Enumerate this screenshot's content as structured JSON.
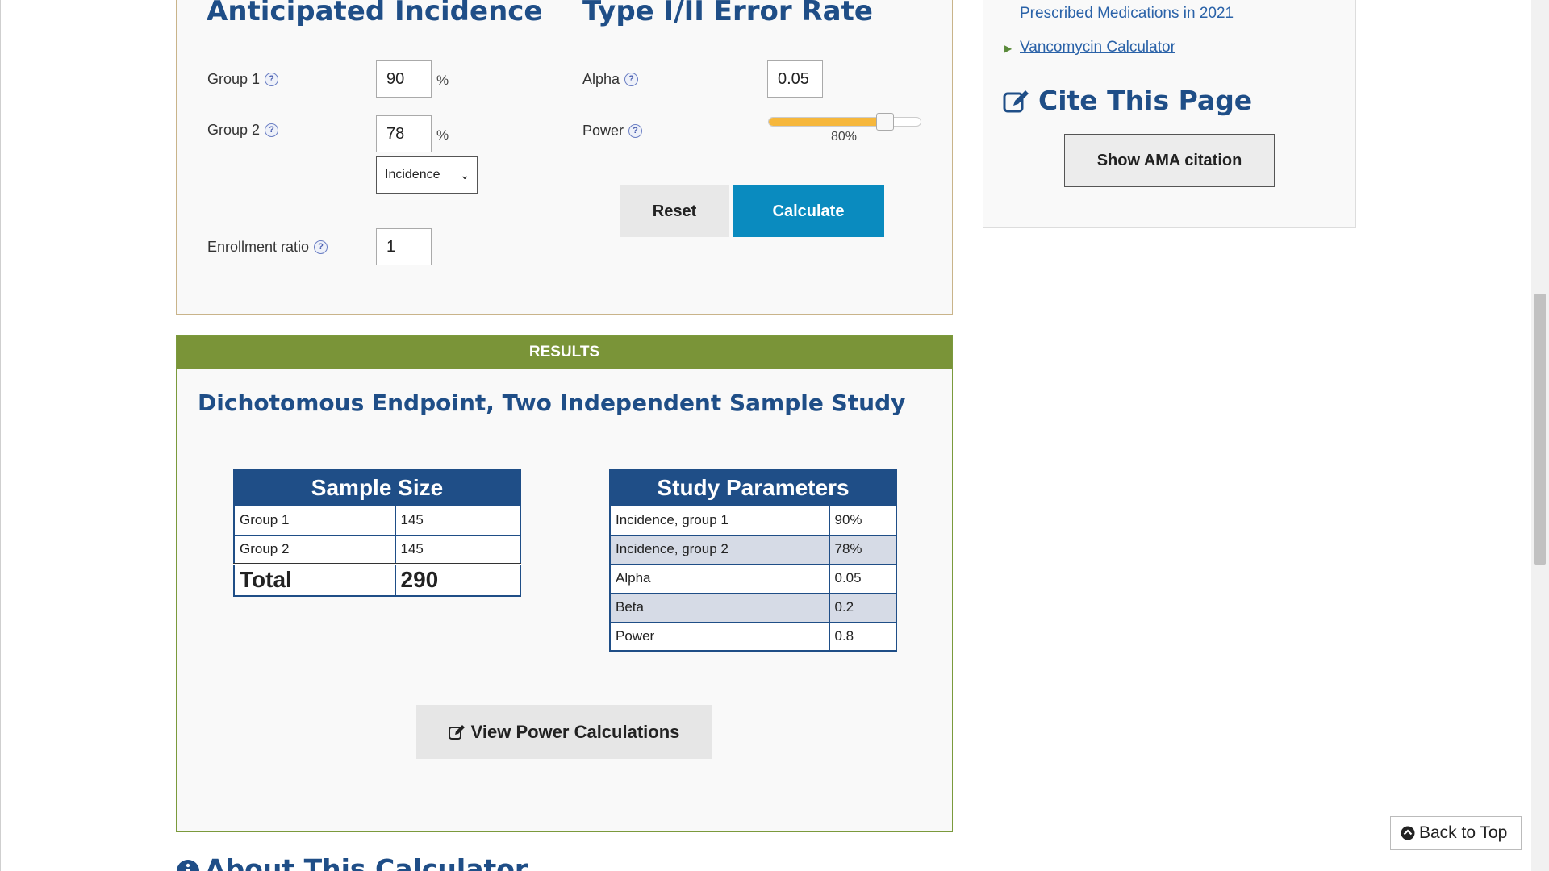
{
  "incidence": {
    "title": "Anticipated Incidence",
    "group1_label": "Group 1",
    "group1_value": "90",
    "group2_label": "Group 2",
    "group2_value": "78",
    "unit": "%",
    "type_select": "Incidence",
    "ratio_label": "Enrollment ratio",
    "ratio_value": "1"
  },
  "error_rate": {
    "title": "Type I/II Error Rate",
    "alpha_label": "Alpha",
    "alpha_value": "0.05",
    "power_label": "Power",
    "power_value_text": "80%",
    "power_fraction": 0.8
  },
  "buttons": {
    "reset": "Reset",
    "calculate": "Calculate",
    "ama": "Show AMA citation",
    "view_power": "View Power Calculations",
    "back_to_top": "Back to Top"
  },
  "sidebar": {
    "link1": "Prescribed Medications in 2021",
    "link2": "Vancomycin Calculator",
    "cite_title": "Cite This Page"
  },
  "results": {
    "header": "RESULTS",
    "title": "Dichotomous Endpoint, Two Independent Sample Study",
    "sample_size": {
      "title": "Sample Size",
      "rows": [
        {
          "label": "Group 1",
          "value": "145"
        },
        {
          "label": "Group 2",
          "value": "145"
        }
      ],
      "total_label": "Total",
      "total_value": "290"
    },
    "study_params": {
      "title": "Study Parameters",
      "rows": [
        {
          "label": "Incidence, group 1",
          "value": "90%"
        },
        {
          "label": "Incidence, group 2",
          "value": "78%"
        },
        {
          "label": "Alpha",
          "value": "0.05"
        },
        {
          "label": "Beta",
          "value": "0.2"
        },
        {
          "label": "Power",
          "value": "0.8"
        }
      ]
    }
  },
  "about": {
    "title": "About This Calculator"
  },
  "colors": {
    "heading": "#1f4e87",
    "results_header": "#7a9438",
    "calculate": "#0a8bbf",
    "slider": "#f6b73c"
  }
}
